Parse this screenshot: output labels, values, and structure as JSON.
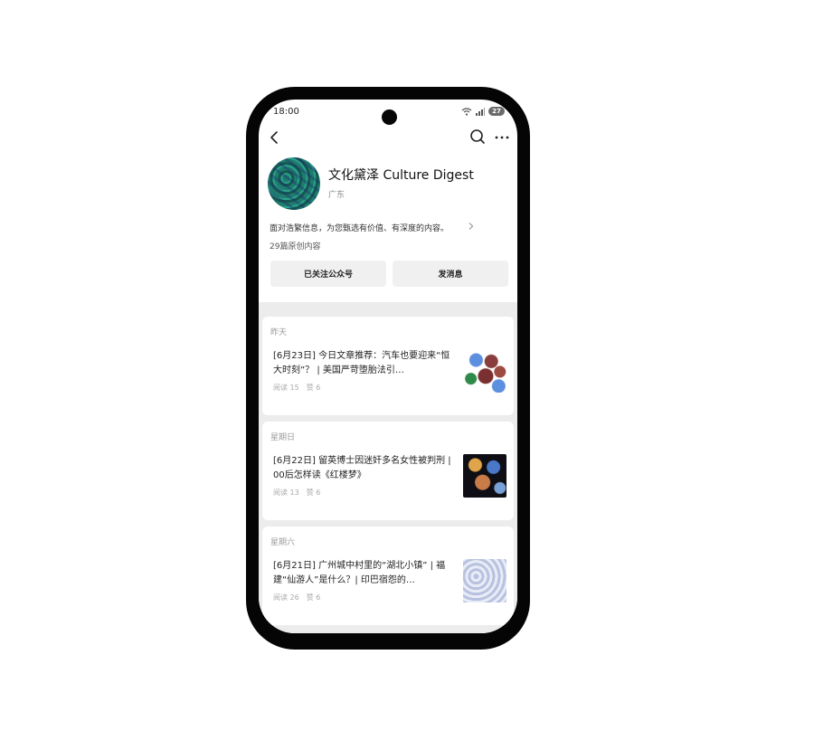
{
  "status_bar": {
    "time": "18:00",
    "battery": "27"
  },
  "account": {
    "name": "文化黛泽 Culture Digest",
    "location": "广东",
    "description": "面对浩繁信息，为您甄选有价值、有深度的内容。",
    "article_count": "29篇原创内容"
  },
  "actions": {
    "follow_label": "已关注公众号",
    "message_label": "发消息"
  },
  "articles": [
    {
      "date": "昨天",
      "title": "[6月23日] 今日文章推荐：汽车也要迎来“恒大时刻”？ | 美国严苛堕胎法引…",
      "reads": "阅读 15",
      "likes": "赞 6"
    },
    {
      "date": "星期日",
      "title": "[6月22日] 留英博士因迷奸多名女性被判刑 | 00后怎样读《红楼梦》",
      "reads": "阅读 13",
      "likes": "赞 6"
    },
    {
      "date": "星期六",
      "title": "[6月21日] 广州城中村里的“湖北小镇” | 福建“仙游人”是什么？| 印巴宿怨的…",
      "reads": "阅读 26",
      "likes": "赞 6"
    }
  ],
  "icons": {
    "back": "chevron-left-icon",
    "search": "search-icon",
    "more": "more-horizontal-icon",
    "wifi": "wifi-icon",
    "signal": "signal-icon",
    "battery": "battery-icon"
  }
}
